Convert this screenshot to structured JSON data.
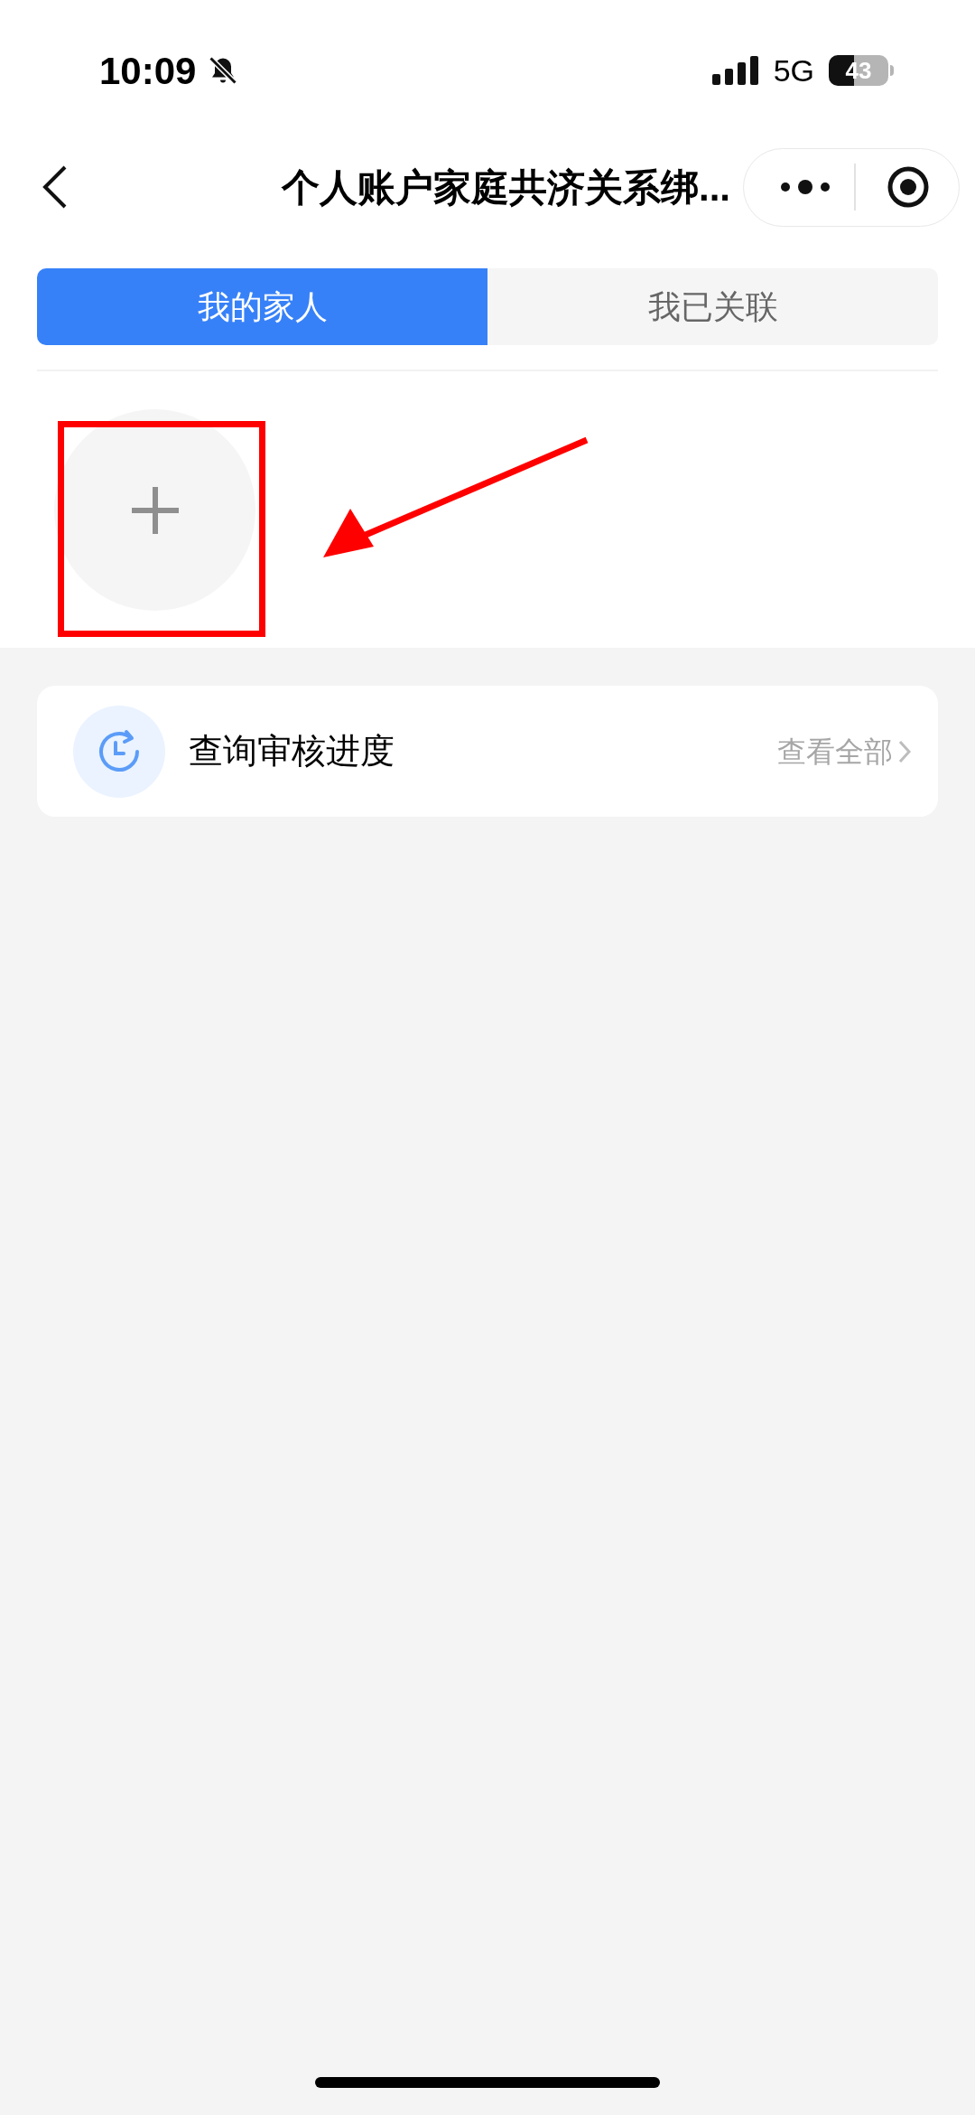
{
  "status_bar": {
    "time": "10:09",
    "network": "5G",
    "battery": "43"
  },
  "nav": {
    "title": "个人账户家庭共济关系绑..."
  },
  "tabs": [
    {
      "label": "我的家人",
      "selected": true
    },
    {
      "label": "我已关联",
      "selected": false
    }
  ],
  "progress_card": {
    "title": "查询审核进度",
    "link": "查看全部"
  }
}
